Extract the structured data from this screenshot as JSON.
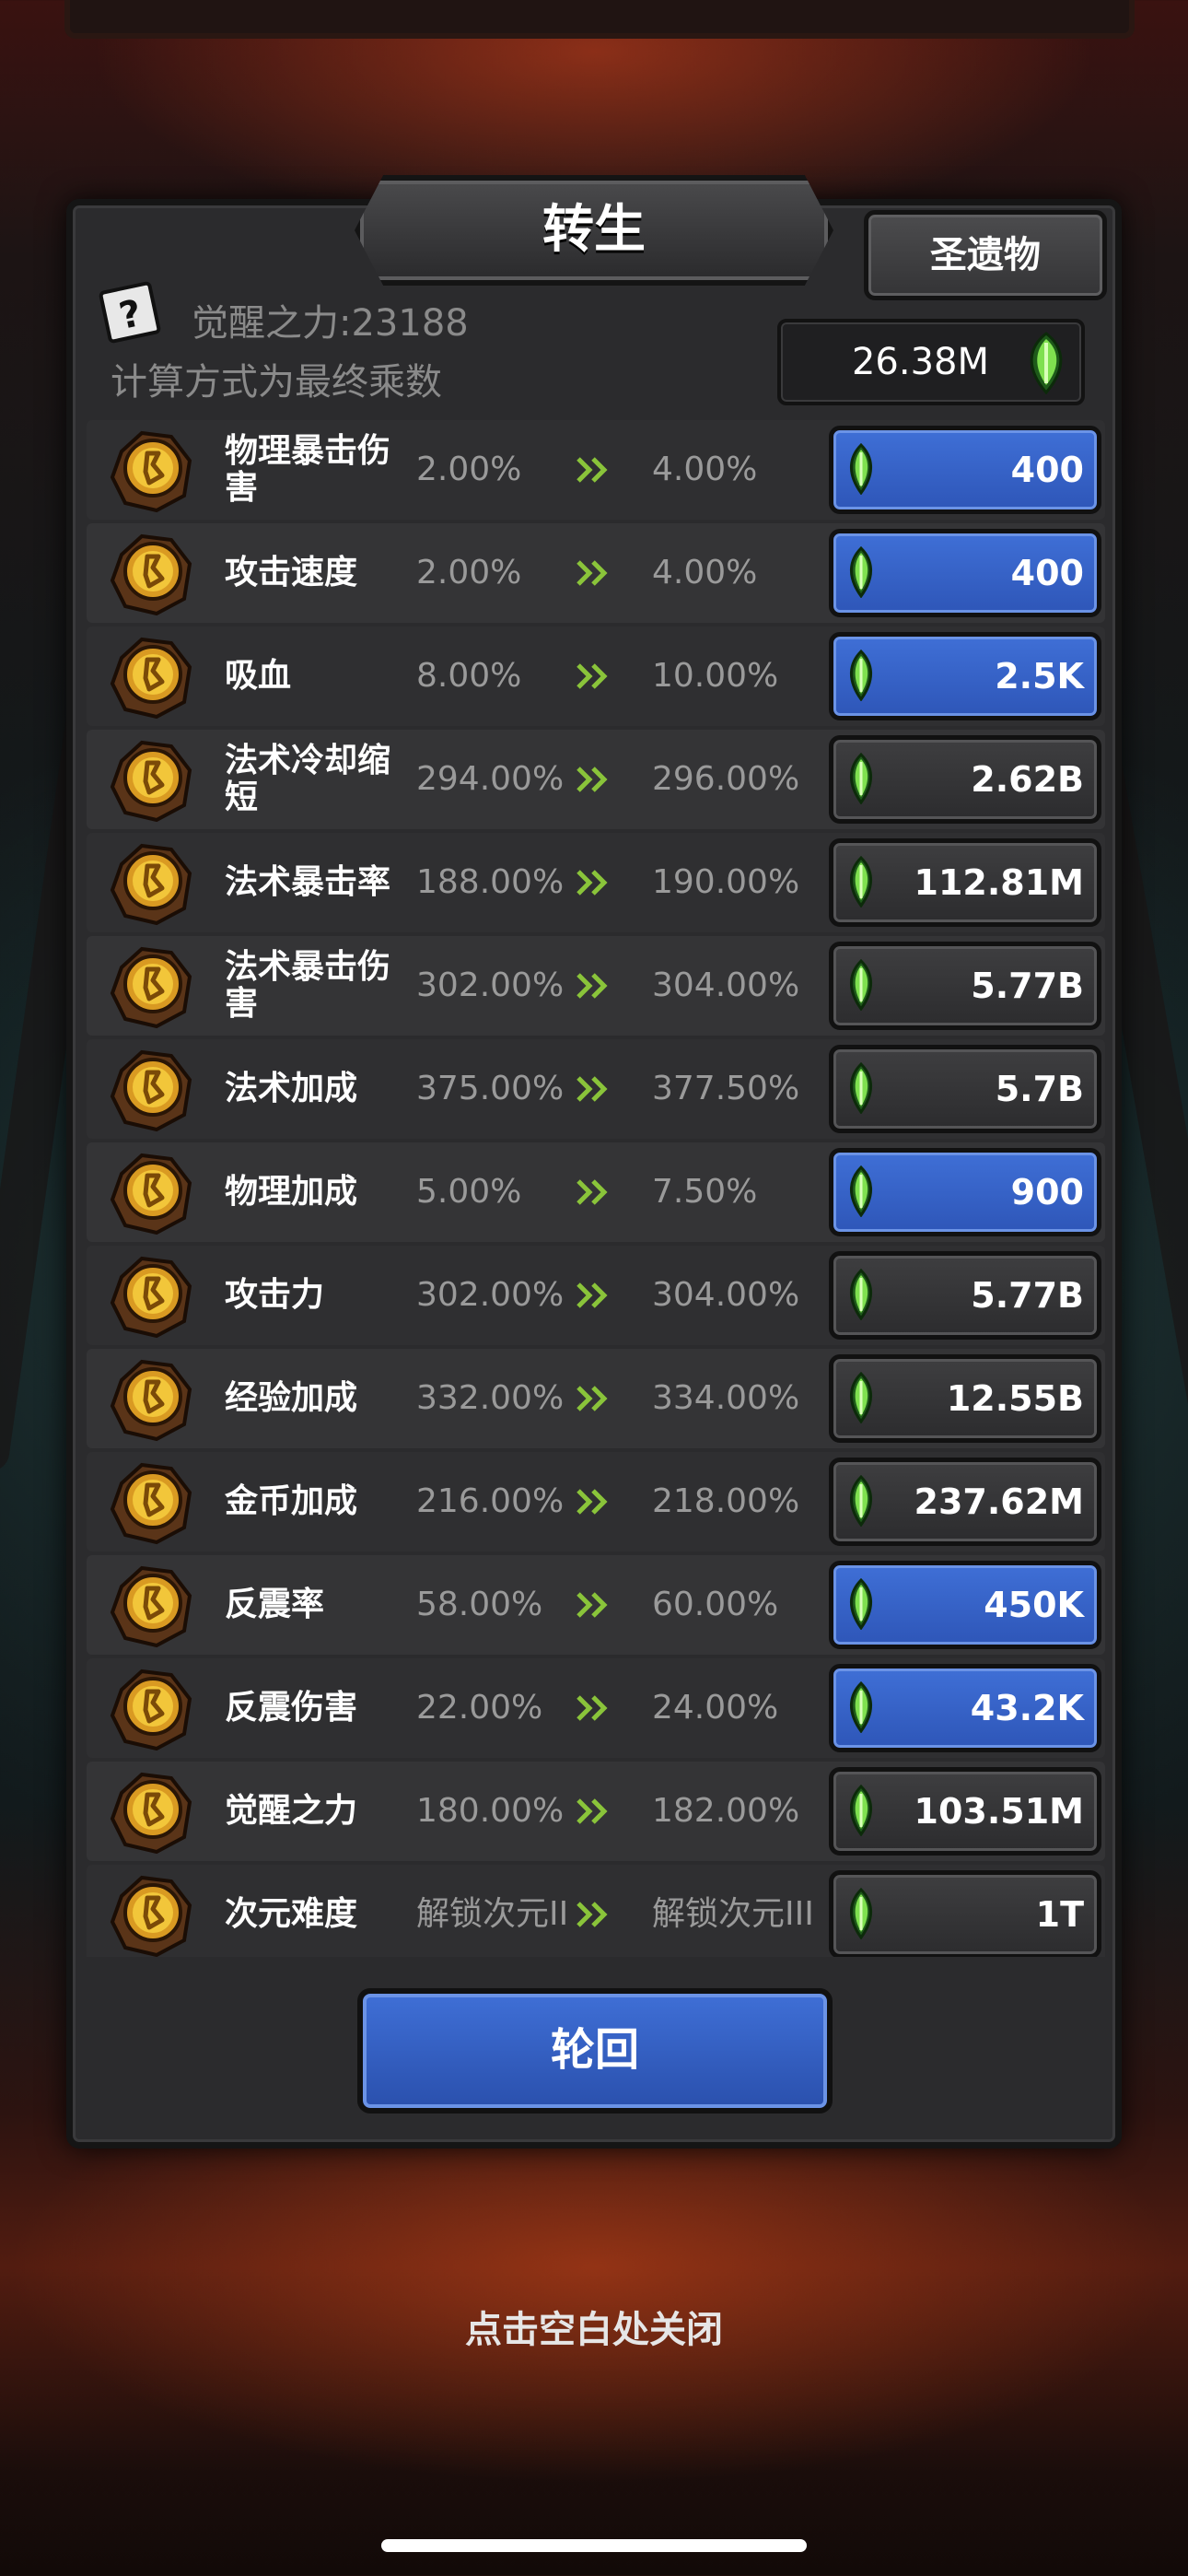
{
  "title": "转生",
  "relic_button": "圣遗物",
  "help_icon_glyph": "?",
  "awaken_power": "觉醒之力:23188",
  "calc_note": "计算方式为最终乘数",
  "currency": "26.38M",
  "colors": {
    "blue_button": "#3f6fd6",
    "gray_button": "#3a3a3c",
    "panel": "#2b2b2d",
    "gem": "#6fd24a"
  },
  "rows": [
    {
      "name": "物理暴击伤害",
      "current": "2.00%",
      "next": "4.00%",
      "cost": "400",
      "affordable": true
    },
    {
      "name": "攻击速度",
      "current": "2.00%",
      "next": "4.00%",
      "cost": "400",
      "affordable": true
    },
    {
      "name": "吸血",
      "current": "8.00%",
      "next": "10.00%",
      "cost": "2.5K",
      "affordable": true
    },
    {
      "name": "法术冷却缩短",
      "current": "294.00%",
      "next": "296.00%",
      "cost": "2.62B",
      "affordable": false
    },
    {
      "name": "法术暴击率",
      "current": "188.00%",
      "next": "190.00%",
      "cost": "112.81M",
      "affordable": false
    },
    {
      "name": "法术暴击伤害",
      "current": "302.00%",
      "next": "304.00%",
      "cost": "5.77B",
      "affordable": false
    },
    {
      "name": "法术加成",
      "current": "375.00%",
      "next": "377.50%",
      "cost": "5.7B",
      "affordable": false
    },
    {
      "name": "物理加成",
      "current": "5.00%",
      "next": "7.50%",
      "cost": "900",
      "affordable": true
    },
    {
      "name": "攻击力",
      "current": "302.00%",
      "next": "304.00%",
      "cost": "5.77B",
      "affordable": false
    },
    {
      "name": "经验加成",
      "current": "332.00%",
      "next": "334.00%",
      "cost": "12.55B",
      "affordable": false
    },
    {
      "name": "金币加成",
      "current": "216.00%",
      "next": "218.00%",
      "cost": "237.62M",
      "affordable": false
    },
    {
      "name": "反震率",
      "current": "58.00%",
      "next": "60.00%",
      "cost": "450K",
      "affordable": true
    },
    {
      "name": "反震伤害",
      "current": "22.00%",
      "next": "24.00%",
      "cost": "43.2K",
      "affordable": true
    },
    {
      "name": "觉醒之力",
      "current": "180.00%",
      "next": "182.00%",
      "cost": "103.51M",
      "affordable": false
    },
    {
      "name": "次元难度",
      "current": "解锁次元II",
      "next": "解锁次元III",
      "cost": "1T",
      "affordable": false
    }
  ],
  "rebirth_button": "轮回",
  "close_hint": "点击空白处关闭"
}
